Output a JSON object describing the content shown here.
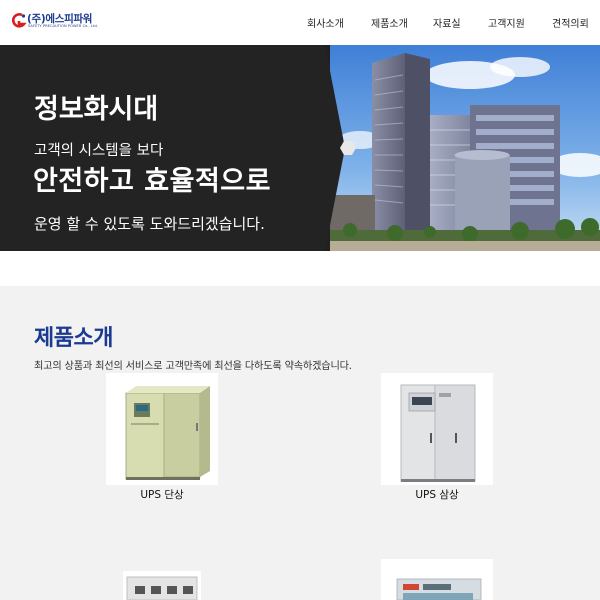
{
  "header": {
    "logo_text": "(주)에스피파워",
    "logo_sub": "SAFETY PRECAUTION POWER Co., Ltd.",
    "nav": [
      "회사소개",
      "제품소개",
      "자료실",
      "고객지원",
      "견적의뢰"
    ]
  },
  "hero": {
    "headline": "정보화시대",
    "line1": "고객의 시스템을 보다",
    "line2": "안전하고 효율적으로",
    "line3": "운영 할 수 있도록 도와드리겠습니다."
  },
  "products": {
    "title": "제품소개",
    "desc": "최고의 상품과 최선의 서비스로 고객만족에 최선을 다하도록 약속하겠습니다.",
    "items": [
      {
        "label": "UPS 단상"
      },
      {
        "label": "UPS 삼상"
      }
    ]
  },
  "colors": {
    "brand_blue": "#1b3a91",
    "hero_dark": "#202020",
    "section_bg": "#f2f2f2"
  }
}
